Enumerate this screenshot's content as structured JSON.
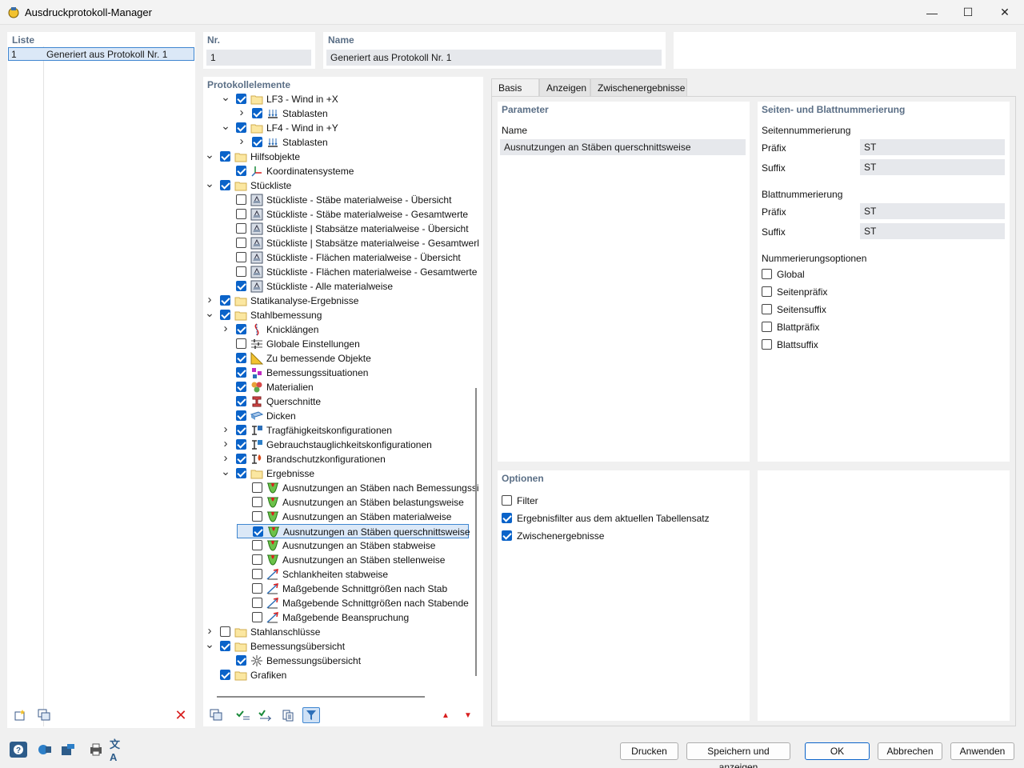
{
  "window": {
    "title": "Ausdruckprotokoll-Manager",
    "minimize": "—",
    "maximize": "☐",
    "close": "✕"
  },
  "list": {
    "header": "Liste",
    "rows": [
      {
        "nr": "1",
        "name": "Generiert aus Protokoll Nr. 1"
      }
    ]
  },
  "nr": {
    "label": "Nr.",
    "value": "1"
  },
  "name": {
    "label": "Name",
    "value": "Generiert aus Protokoll Nr. 1"
  },
  "tree": {
    "header": "Protokollelemente",
    "items": [
      {
        "label": "LF3 - Wind in +X",
        "checked": true,
        "chev": "down",
        "icon": "folder-icon",
        "level": 2
      },
      {
        "label": "Stablasten",
        "checked": true,
        "chev": "right",
        "icon": "member-load-icon",
        "level": 3
      },
      {
        "label": "LF4 - Wind in +Y",
        "checked": true,
        "chev": "down",
        "icon": "folder-icon",
        "level": 2
      },
      {
        "label": "Stablasten",
        "checked": true,
        "chev": "right",
        "icon": "member-load-icon",
        "level": 3
      },
      {
        "label": "Hilfsobjekte",
        "checked": true,
        "chev": "down",
        "icon": "folder-icon",
        "level": 1
      },
      {
        "label": "Koordinatensysteme",
        "checked": true,
        "chev": "",
        "icon": "coordinate-system-icon",
        "level": 2
      },
      {
        "label": "Stückliste",
        "checked": true,
        "chev": "down",
        "icon": "folder-icon",
        "level": 1
      },
      {
        "label": "Stückliste - Stäbe materialweise - Übersicht",
        "checked": false,
        "chev": "",
        "icon": "parts-list-icon",
        "level": 2
      },
      {
        "label": "Stückliste - Stäbe materialweise - Gesamtwerte",
        "checked": false,
        "chev": "",
        "icon": "parts-list-icon",
        "level": 2
      },
      {
        "label": "Stückliste | Stabsätze materialweise - Übersicht",
        "checked": false,
        "chev": "",
        "icon": "parts-list-icon",
        "level": 2
      },
      {
        "label": "Stückliste | Stabsätze materialweise - Gesamtwerl",
        "checked": false,
        "chev": "",
        "icon": "parts-list-icon",
        "level": 2
      },
      {
        "label": "Stückliste - Flächen materialweise - Übersicht",
        "checked": false,
        "chev": "",
        "icon": "parts-list-icon",
        "level": 2
      },
      {
        "label": "Stückliste - Flächen materialweise - Gesamtwerte",
        "checked": false,
        "chev": "",
        "icon": "parts-list-icon",
        "level": 2
      },
      {
        "label": "Stückliste - Alle materialweise",
        "checked": true,
        "chev": "",
        "icon": "parts-list-icon",
        "level": 2
      },
      {
        "label": "Statikanalyse-Ergebnisse",
        "checked": true,
        "chev": "right",
        "icon": "folder-icon",
        "level": 1
      },
      {
        "label": "Stahlbemessung",
        "checked": true,
        "chev": "down",
        "icon": "folder-icon",
        "level": 1
      },
      {
        "label": "Knicklängen",
        "checked": true,
        "chev": "right",
        "icon": "buckling-length-icon",
        "level": 2
      },
      {
        "label": "Globale Einstellungen",
        "checked": false,
        "chev": "",
        "icon": "settings-sliders-icon",
        "level": 2
      },
      {
        "label": "Zu bemessende Objekte",
        "checked": true,
        "chev": "",
        "icon": "design-objects-icon",
        "level": 2
      },
      {
        "label": "Bemessungssituationen",
        "checked": true,
        "chev": "",
        "icon": "design-situations-icon",
        "level": 2
      },
      {
        "label": "Materialien",
        "checked": true,
        "chev": "",
        "icon": "materials-icon",
        "level": 2
      },
      {
        "label": "Querschnitte",
        "checked": true,
        "chev": "",
        "icon": "cross-section-icon",
        "level": 2
      },
      {
        "label": "Dicken",
        "checked": true,
        "chev": "",
        "icon": "thickness-icon",
        "level": 2
      },
      {
        "label": "Tragfähigkeitskonfigurationen",
        "checked": true,
        "chev": "right",
        "icon": "uls-config-icon",
        "level": 2
      },
      {
        "label": "Gebrauchstauglichkeitskonfigurationen",
        "checked": true,
        "chev": "right",
        "icon": "sls-config-icon",
        "level": 2
      },
      {
        "label": "Brandschutzkonfigurationen",
        "checked": true,
        "chev": "right",
        "icon": "fire-config-icon",
        "level": 2
      },
      {
        "label": "Ergebnisse",
        "checked": true,
        "chev": "down",
        "icon": "folder-icon",
        "level": 2
      },
      {
        "label": "Ausnutzungen an Stäben nach Bemessungssi",
        "checked": false,
        "chev": "",
        "icon": "utilization-icon",
        "level": 3
      },
      {
        "label": "Ausnutzungen an Stäben belastungsweise",
        "checked": false,
        "chev": "",
        "icon": "utilization-icon",
        "level": 3
      },
      {
        "label": "Ausnutzungen an Stäben materialweise",
        "checked": false,
        "chev": "",
        "icon": "utilization-icon",
        "level": 3
      },
      {
        "label": "Ausnutzungen an Stäben querschnittsweise",
        "checked": true,
        "chev": "",
        "icon": "utilization-icon",
        "level": 3,
        "selected": true
      },
      {
        "label": "Ausnutzungen an Stäben stabweise",
        "checked": false,
        "chev": "",
        "icon": "utilization-icon",
        "level": 3
      },
      {
        "label": "Ausnutzungen an Stäben stellenweise",
        "checked": false,
        "chev": "",
        "icon": "utilization-icon",
        "level": 3
      },
      {
        "label": "Schlankheiten stabweise",
        "checked": false,
        "chev": "",
        "icon": "slenderness-icon",
        "level": 3
      },
      {
        "label": "Maßgebende Schnittgrößen nach Stab",
        "checked": false,
        "chev": "",
        "icon": "slenderness-icon",
        "level": 3
      },
      {
        "label": "Maßgebende Schnittgrößen nach Stabende",
        "checked": false,
        "chev": "",
        "icon": "slenderness-icon",
        "level": 3
      },
      {
        "label": "Maßgebende Beanspruchung",
        "checked": false,
        "chev": "",
        "icon": "slenderness-icon",
        "level": 3
      },
      {
        "label": "Stahlanschlüsse",
        "checked": false,
        "chev": "right",
        "icon": "folder-icon",
        "level": 1
      },
      {
        "label": "Bemessungsübersicht",
        "checked": true,
        "chev": "down",
        "icon": "folder-icon",
        "level": 1
      },
      {
        "label": "Bemessungsübersicht",
        "checked": true,
        "chev": "",
        "icon": "design-overview-icon",
        "level": 2
      },
      {
        "label": "Grafiken",
        "checked": true,
        "chev": "",
        "icon": "folder-icon",
        "level": 1
      }
    ]
  },
  "tabs": [
    {
      "label": "Basis",
      "active": true
    },
    {
      "label": "Anzeigen",
      "active": false
    },
    {
      "label": "Zwischenergebnisse",
      "active": false
    }
  ],
  "parameter": {
    "header": "Parameter",
    "name_label": "Name",
    "name_value": "Ausnutzungen an Stäben querschnittsweise"
  },
  "numbering": {
    "header": "Seiten- und Blattnummerierung",
    "page_header": "Seitennummerierung",
    "page_prefix_label": "Präfix",
    "page_prefix_value": "ST",
    "page_suffix_label": "Suffix",
    "page_suffix_value": "ST",
    "sheet_header": "Blattnummerierung",
    "sheet_prefix_label": "Präfix",
    "sheet_prefix_value": "ST",
    "sheet_suffix_label": "Suffix",
    "sheet_suffix_value": "ST",
    "options_header": "Nummerierungsoptionen",
    "options": [
      {
        "label": "Global",
        "checked": false
      },
      {
        "label": "Seitenpräfix",
        "checked": false
      },
      {
        "label": "Seitensuffix",
        "checked": false
      },
      {
        "label": "Blattpräfix",
        "checked": false
      },
      {
        "label": "Blattsuffix",
        "checked": false
      }
    ]
  },
  "options": {
    "header": "Optionen",
    "items": [
      {
        "label": "Filter",
        "checked": false
      },
      {
        "label": "Ergebnisfilter aus dem aktuellen Tabellensatz",
        "checked": true
      },
      {
        "label": "Zwischenergebnisse",
        "checked": true
      }
    ]
  },
  "footer": {
    "print": "Drucken",
    "save_show": "Speichern und anzeigen",
    "ok": "OK",
    "cancel": "Abbrechen",
    "apply": "Anwenden"
  },
  "colors": {
    "accent": "#0a63c9",
    "section_label": "#5b6f86",
    "delete_red": "#d81e1e"
  }
}
